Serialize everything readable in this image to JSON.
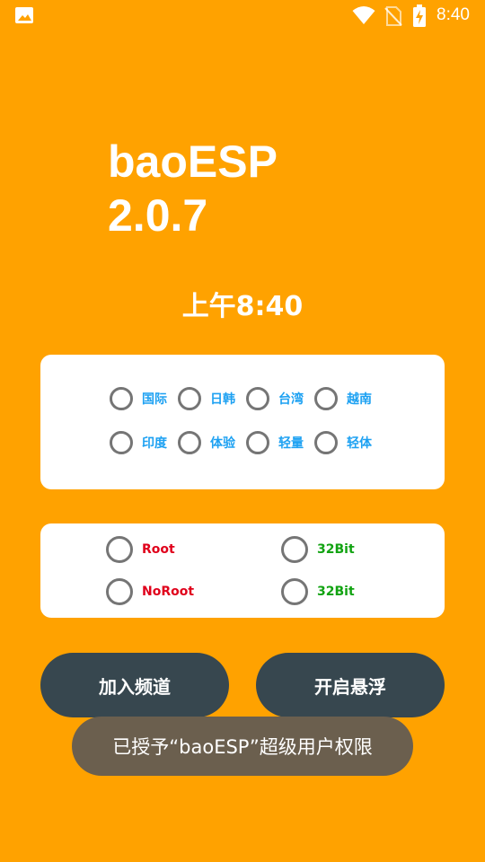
{
  "status_bar": {
    "time": "8:40",
    "icons": [
      "image-icon",
      "wifi-icon",
      "no-sim-icon",
      "battery-charging-icon"
    ]
  },
  "app": {
    "title": "baoESP\n2.0.7",
    "clock": "上午8:40"
  },
  "region_options": [
    {
      "label": "国际",
      "selected": false
    },
    {
      "label": "日韩",
      "selected": false
    },
    {
      "label": "台湾",
      "selected": false
    },
    {
      "label": "越南",
      "selected": false
    },
    {
      "label": "印度",
      "selected": false
    },
    {
      "label": "体验",
      "selected": false
    },
    {
      "label": "轻量",
      "selected": false
    },
    {
      "label": "轻体",
      "selected": false
    }
  ],
  "mode_options": [
    {
      "label": "Root",
      "selected": false
    },
    {
      "label": "32Bit",
      "selected": false
    },
    {
      "label": "NoRoot",
      "selected": false
    },
    {
      "label": "32Bit",
      "selected": false
    }
  ],
  "buttons": {
    "join_channel": "加入频道",
    "open_float": "开启悬浮"
  },
  "toast": "已授予“baoESP”超级用户权限",
  "colors": {
    "background": "#FFA200",
    "card": "#FFFFFF",
    "button": "#37474F",
    "toast": "#6B5F4E",
    "region_label": "#1DA1F2",
    "root_label": "#E0001B",
    "bit_label": "#12A312"
  }
}
